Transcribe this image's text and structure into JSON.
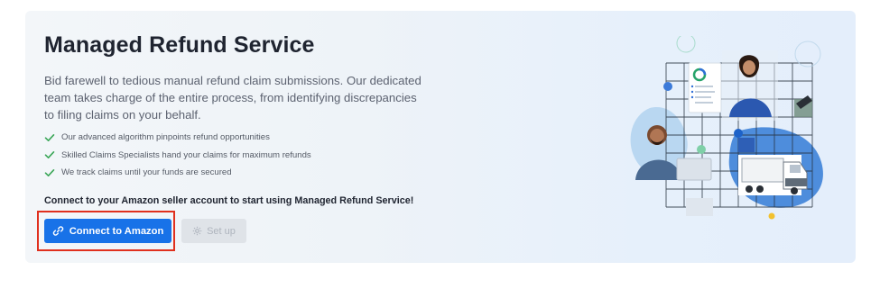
{
  "service": {
    "title": "Managed Refund Service",
    "description": "Bid farewell to tedious manual refund claim submissions. Our dedicated team takes charge of the entire process, from identifying discrepancies to filing claims on your behalf.",
    "features": [
      "Our advanced algorithm pinpoints refund opportunities",
      "Skilled Claims Specialists hand your claims for maximum refunds",
      "We track claims until your funds are secured"
    ],
    "cta_text": "Connect to your Amazon seller account to start using Managed Refund Service!"
  },
  "actions": {
    "connect_label": "Connect to Amazon",
    "connect_icon": "link-icon",
    "setup_label": "Set up",
    "setup_icon": "gear-icon"
  },
  "colors": {
    "primary": "#1872e8",
    "check": "#3aa657",
    "highlight": "#e0301e",
    "disabled_bg": "#dfe3e8"
  }
}
